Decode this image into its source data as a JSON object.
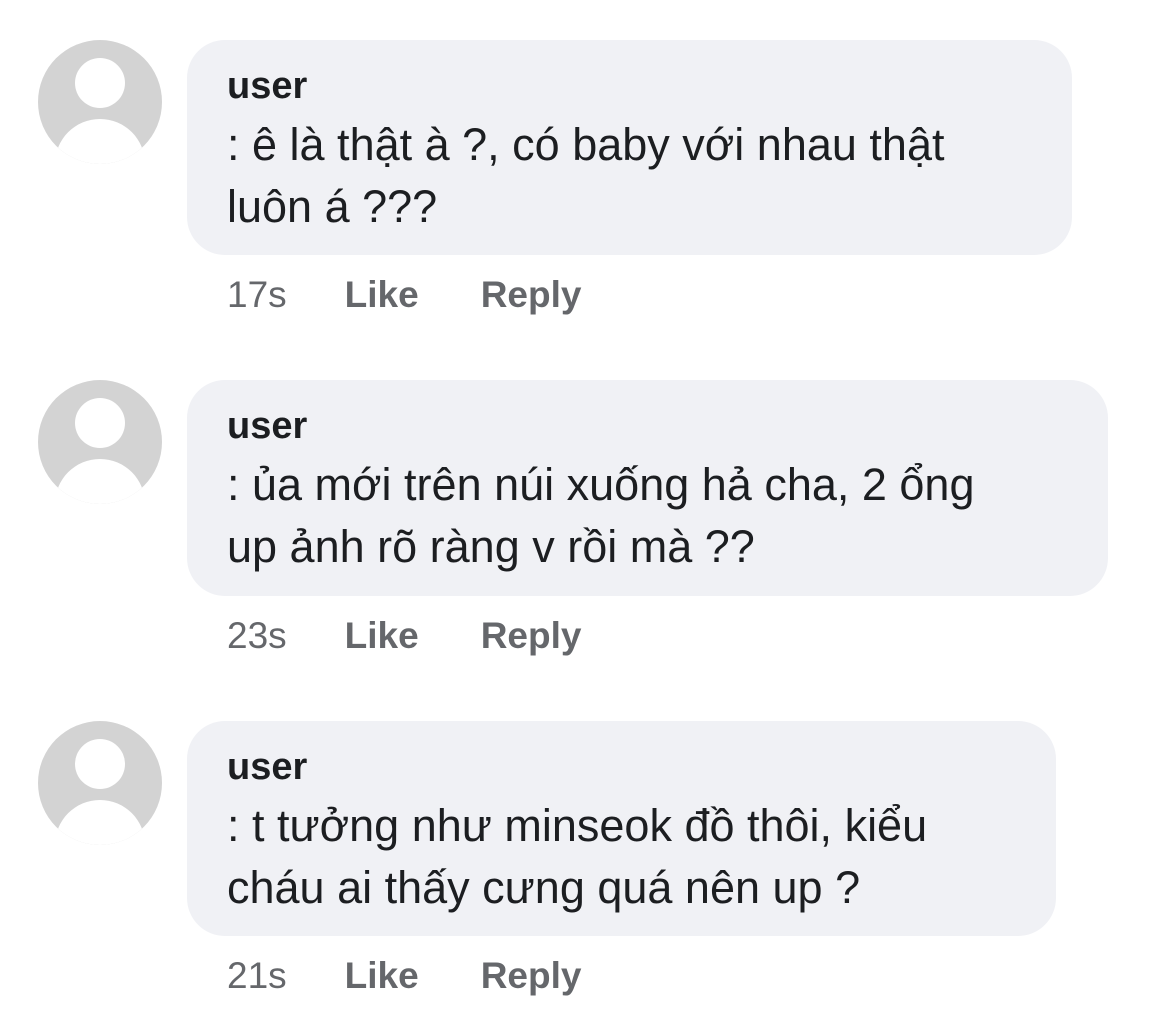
{
  "comments": [
    {
      "username": "user",
      "text_line1": ": ê là thật à ?, có baby với nhau thật",
      "text_line2": "luôn á ???",
      "time": "17s",
      "like_label": "Like",
      "reply_label": "Reply"
    },
    {
      "username": "user",
      "text_line1": ": ủa mới trên núi xuống hả cha, 2 ổng",
      "text_line2": "up ảnh rõ ràng v rồi mà ??",
      "time": "23s",
      "like_label": "Like",
      "reply_label": "Reply"
    },
    {
      "username": "user",
      "text_line1": ": t tưởng như minseok đồ thôi, kiểu",
      "text_line2": "cháu ai thấy cưng quá nên up ?",
      "time": "21s",
      "like_label": "Like",
      "reply_label": "Reply"
    }
  ],
  "colors": {
    "bubble_bg": "#f0f1f5",
    "avatar_bg": "#d3d3d3",
    "text": "#1c1e21",
    "meta": "#65676b"
  }
}
